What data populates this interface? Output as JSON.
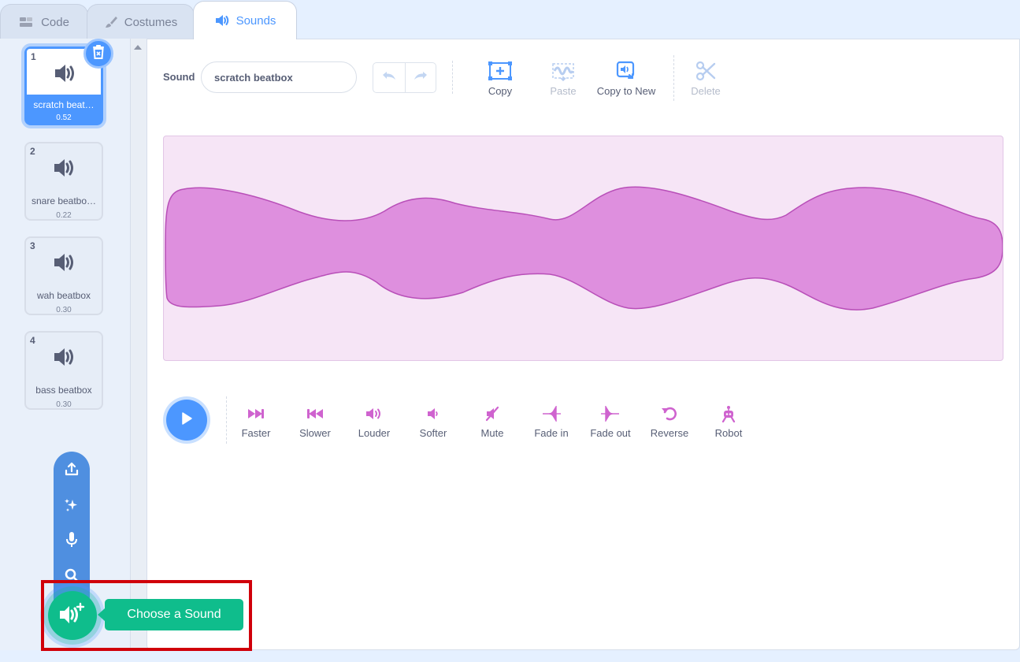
{
  "tabs": [
    {
      "label": "Code",
      "icon": "code-icon"
    },
    {
      "label": "Costumes",
      "icon": "brush-icon"
    },
    {
      "label": "Sounds",
      "icon": "speaker-icon",
      "active": true
    }
  ],
  "sounds": [
    {
      "num": "1",
      "name": "scratch beat…",
      "duration": "0.52",
      "selected": true
    },
    {
      "num": "2",
      "name": "snare beatbo…",
      "duration": "0.22"
    },
    {
      "num": "3",
      "name": "wah beatbox",
      "duration": "0.30"
    },
    {
      "num": "4",
      "name": "bass beatbox",
      "duration": "0.30"
    }
  ],
  "editor": {
    "sound_label": "Sound",
    "sound_name": "scratch beatbox",
    "tools": {
      "copy": "Copy",
      "paste": "Paste",
      "copy_to_new": "Copy to New",
      "delete": "Delete"
    },
    "effects": {
      "faster": "Faster",
      "slower": "Slower",
      "louder": "Louder",
      "softer": "Softer",
      "mute": "Mute",
      "fade_in": "Fade in",
      "fade_out": "Fade out",
      "reverse": "Reverse",
      "robot": "Robot"
    }
  },
  "add_menu": {
    "tooltip": "Choose a Sound",
    "items": [
      "upload-icon",
      "surprise-icon",
      "microphone-icon",
      "search-icon"
    ]
  },
  "colors": {
    "accent": "#4c97ff",
    "sound_green": "#0fbd8c",
    "effect_magenta": "#cf63cf",
    "waveform_fill": "#de8fde",
    "waveform_stroke": "#b84fb8",
    "highlight_red": "#d0000a"
  }
}
